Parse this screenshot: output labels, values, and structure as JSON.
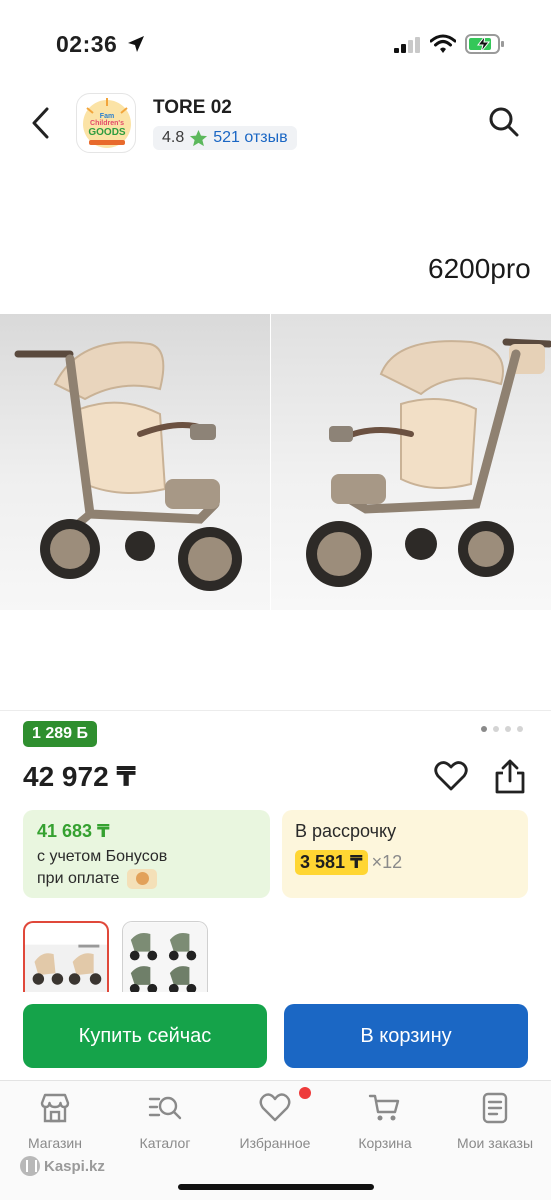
{
  "status_bar": {
    "time": "02:36"
  },
  "header": {
    "store_name": "TORE 02",
    "rating": "4.8",
    "reviews": "521 отзыв",
    "logo_text": [
      "Fam",
      "Children's",
      "GOODS"
    ]
  },
  "gallery": {
    "model_label": "6200pro",
    "pages": 4,
    "active_page": 1
  },
  "product": {
    "bonus_badge": "1 289 Б",
    "price": "42 972 ₸"
  },
  "bonus_card": {
    "price": "41 683 ₸",
    "line1": "с учетом Бонусов",
    "line2": "при оплате"
  },
  "credit_card": {
    "title": "В рассрочку",
    "monthly": "3 581 ₸",
    "months": "×12"
  },
  "actions": {
    "buy_now": "Купить сейчас",
    "add_to_cart": "В корзину"
  },
  "tabbar": {
    "items": [
      {
        "label": "Магазин",
        "icon": "store-icon"
      },
      {
        "label": "Каталог",
        "icon": "catalog-search-icon"
      },
      {
        "label": "Избранное",
        "icon": "heart-icon"
      },
      {
        "label": "Корзина",
        "icon": "cart-icon"
      },
      {
        "label": "Мои заказы",
        "icon": "orders-icon"
      }
    ],
    "brand": "Kaspi.kz"
  },
  "colors": {
    "brand_red": "#ee3b3b",
    "buy_green": "#15a34a",
    "cart_blue": "#1b67c4",
    "bonus_green": "#2f8f2f",
    "credit_yellow": "#ffd633"
  }
}
